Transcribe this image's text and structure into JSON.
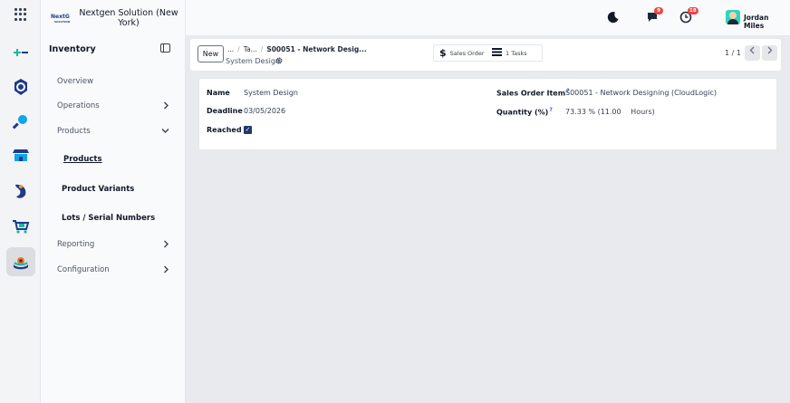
{
  "brand": {
    "logo_text": "NextGen SOLUTIONS",
    "company_name": "Nextgen Solution (New York)"
  },
  "sidebar": {
    "title": "Inventory",
    "items": [
      {
        "label": "Overview"
      },
      {
        "label": "Operations"
      },
      {
        "label": "Products"
      },
      {
        "label": "Products"
      },
      {
        "label": "Product Variants"
      },
      {
        "label": "Lots / Serial Numbers"
      },
      {
        "label": "Reporting"
      },
      {
        "label": "Configuration"
      }
    ]
  },
  "topbar": {
    "messages_badge": "9",
    "activities_badge": "18",
    "user_name": "Jordan Miles"
  },
  "control": {
    "new_label": "New",
    "breadcrumb": [
      "...",
      "Ta...",
      "S00051 - Network Desig..."
    ],
    "record_name": "System Design",
    "smart_buttons": [
      {
        "icon": "dollar-icon",
        "label": "Sales Order"
      },
      {
        "icon": "tasks-icon",
        "label": "1 Tasks"
      }
    ],
    "pager": "1 / 1"
  },
  "form": {
    "name_label": "Name",
    "name_value": "System Design",
    "deadline_label": "Deadline",
    "deadline_value": "03/05/2026",
    "reached_label": "Reached",
    "reached_checked": true,
    "sales_order_item_label": "Sales Order Item",
    "sales_order_item_value": "S00051 - Network Designing (CloudLogic)",
    "quantity_label": "Quantity (%)",
    "quantity_value": "73.33 % (11.00",
    "quantity_unit": "Hours)",
    "help_mark": "?"
  },
  "colors": {
    "accent_dark": "#1f3a68",
    "badge": "#ef4444",
    "background": "#e9eaed"
  }
}
